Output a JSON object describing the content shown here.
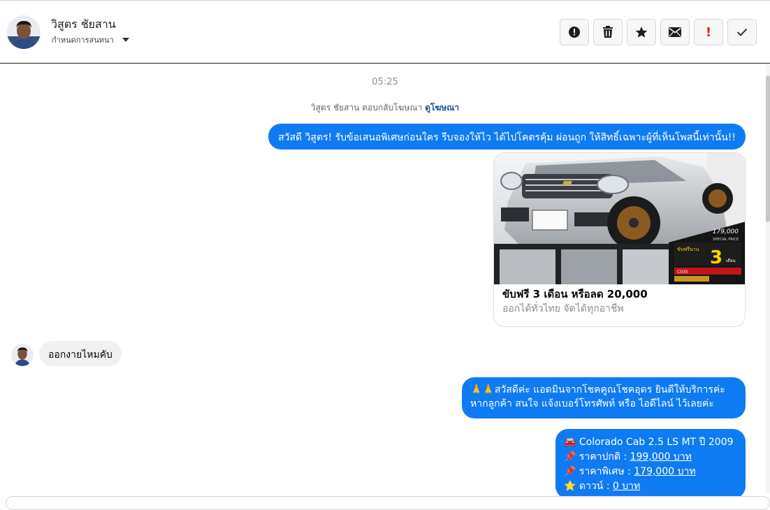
{
  "header": {
    "contact_name": "วิสูตร ชัยสาน",
    "status": "กำหนดการสนทนา",
    "actions": [
      {
        "name": "alert-circle",
        "label": ""
      },
      {
        "name": "trash",
        "label": ""
      },
      {
        "name": "star",
        "label": ""
      },
      {
        "name": "envelope",
        "label": ""
      },
      {
        "name": "exclamation",
        "label": "!"
      },
      {
        "name": "check",
        "label": ""
      }
    ]
  },
  "conversation": {
    "timestamp": "05:25",
    "ad_reply": {
      "text": "วิสูตร ชัยสาน ตอบกลับโฆษณา",
      "link": "ดูโฆษณา"
    },
    "greeting": "สวัสดี วิสูตร! รับข้อเสนอพิเศษก่อนใคร รีบจองให้ไว ได้ไปโคตรคุ้ม ผ่อนถูก ให้สิทธิ์เฉพาะผู้ที่เห็นโพสนี้เท่านั้น!!",
    "ad_card": {
      "title": "ขับฟรี 3 เดือน หรือลด 20,000",
      "subtitle": "ออกได้ทั่วไทย จัดได้ทุกอาชีพ",
      "image_text": {
        "price": "179,000",
        "special": "SPECIAL PRICE",
        "free_label": "ขับฟรีนาน",
        "big_number": "3",
        "unit": "เดือน",
        "code": "C035"
      }
    },
    "incoming": "ออกงายไหมคับ",
    "reply1": {
      "line1": "🙏🙏สวัสดีค่ะ แอดมินจากโชคคูณโชคอุดร ยินดีให้บริการค่ะ",
      "line2": "หากลูกค้า สนใจ แจ้งเบอร์โทรศัพท์ หรือ ไอดีไลน์  ไว้เลยค่ะ"
    },
    "reply2": {
      "model": "🚘 Colorado Cab 2.5 LS MT ปี 2009",
      "normal_label": "📌 ราคาปกติ : ",
      "normal_price": "199,000 บาท",
      "special_label": "📌 ราคาพิเศษ : ",
      "special_price": "179,000 บาท",
      "down_label": "⭐ ดาวน์ : ",
      "down_value": "0 บาท"
    }
  }
}
